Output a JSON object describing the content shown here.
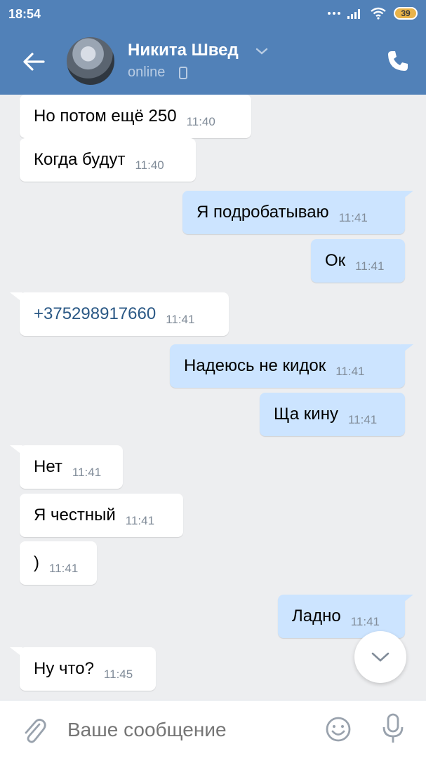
{
  "status_bar": {
    "time": "18:54",
    "battery": "39",
    "icons": [
      "dots-icon",
      "signal-icon",
      "wifi-icon",
      "battery-icon"
    ]
  },
  "header": {
    "contact_name": "Никита Швед",
    "status": "online",
    "icons": [
      "back-arrow-icon",
      "chevron-down-icon",
      "mobile-phone-icon",
      "phone-call-icon"
    ]
  },
  "messages": [
    {
      "direction": "in",
      "text": "Но потом ещё 250",
      "time": "11:40"
    },
    {
      "direction": "in",
      "text": "Когда будут",
      "time": "11:40"
    },
    {
      "direction": "out",
      "text": "Я подробатываю",
      "time": "11:41"
    },
    {
      "direction": "out",
      "text": "Ок",
      "time": "11:41"
    },
    {
      "direction": "in",
      "text": "+375298917660",
      "time": "11:41",
      "is_link": true
    },
    {
      "direction": "out",
      "text": "Надеюсь не кидок",
      "time": "11:41"
    },
    {
      "direction": "out",
      "text": "Ща кину",
      "time": "11:41"
    },
    {
      "direction": "in",
      "text": "Нет",
      "time": "11:41"
    },
    {
      "direction": "in",
      "text": "Я честный",
      "time": "11:41"
    },
    {
      "direction": "in",
      "text": ")",
      "time": "11:41"
    },
    {
      "direction": "out",
      "text": "Ладно",
      "time": "11:41"
    },
    {
      "direction": "in",
      "text": "Ну что?",
      "time": "11:45"
    }
  ],
  "composer": {
    "placeholder": "Ваше сообщение",
    "icons": [
      "paperclip-icon",
      "smiley-icon",
      "microphone-icon",
      "scroll-down-chevron-icon"
    ]
  },
  "colors": {
    "header_bg": "#5181b8",
    "chat_bg": "#edeef0",
    "incoming_bubble": "#ffffff",
    "outgoing_bubble": "#cce4ff",
    "link": "#2a5885",
    "timestamp": "#818c99"
  }
}
